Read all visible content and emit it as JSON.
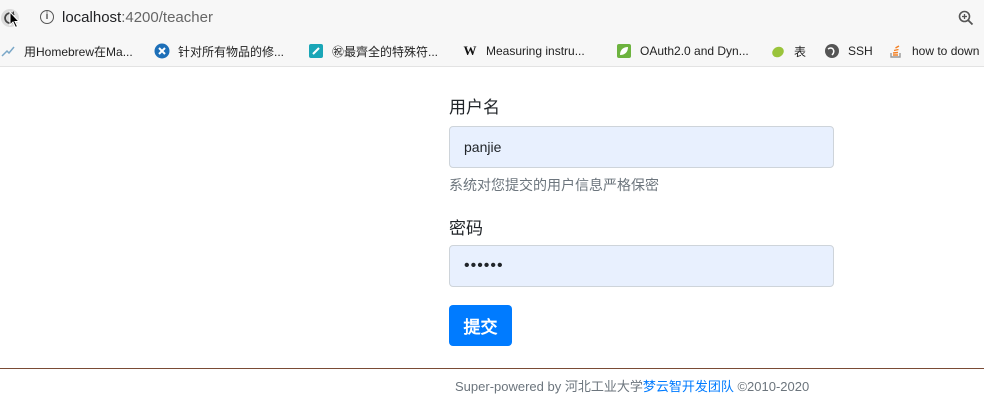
{
  "browser": {
    "url_host": "localhost",
    "url_path": ":4200/teacher",
    "bookmarks": [
      {
        "label": "用Homebrew在Ma...",
        "icon": "brew-icon"
      },
      {
        "label": "针对所有物品的修...",
        "icon": "close-circle-icon"
      },
      {
        "label": "㊗最齊全的特殊符...",
        "icon": "tool-icon"
      },
      {
        "label": "Measuring instru...",
        "icon": "wikipedia-icon"
      },
      {
        "label": "OAuth2.0 and Dyn...",
        "icon": "leaf-icon"
      },
      {
        "label": "表",
        "icon": "pear-icon"
      },
      {
        "label": "SSH",
        "icon": "globe-icon"
      },
      {
        "label": "how to down",
        "icon": "stack-icon"
      }
    ]
  },
  "form": {
    "username_label": "用户名",
    "username_value": "panjie",
    "username_help": "系统对您提交的用户信息严格保密",
    "password_label": "密码",
    "password_value": "••••••",
    "submit_label": "提交"
  },
  "footer": {
    "prefix": "Super-powered by 河北工业大学",
    "team": "梦云智开发团队",
    "suffix": " ©2010-2020"
  }
}
